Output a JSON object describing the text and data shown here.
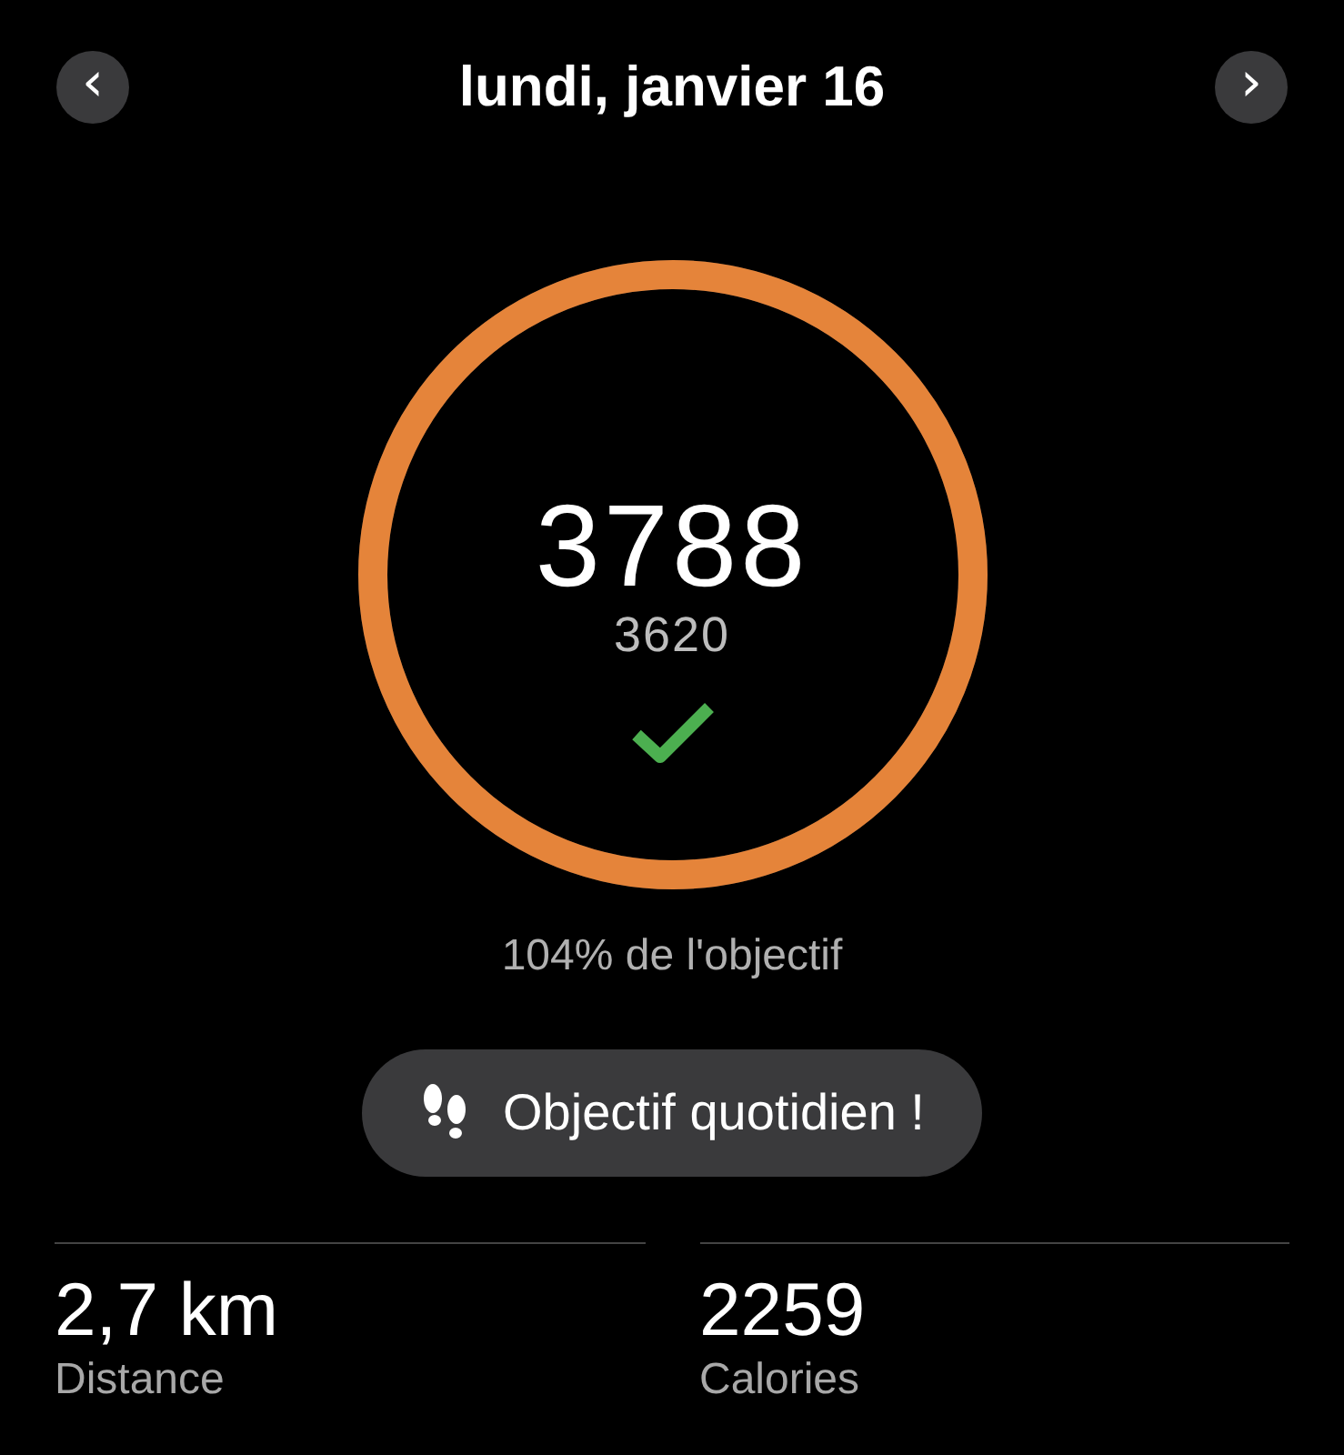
{
  "header": {
    "prev": "‹",
    "title": "lundi, janvier 16",
    "next": "›"
  },
  "ring": {
    "level": 1,
    "steps": "3788",
    "goal": "3620",
    "goal_met": true
  },
  "progress_text": "104% de l'objectif",
  "badge": {
    "label": "Objectif quotidien !"
  },
  "stats": [
    {
      "value": "2,7 km",
      "label": "Distance"
    },
    {
      "value": "2259",
      "label": "Calories"
    }
  ]
}
